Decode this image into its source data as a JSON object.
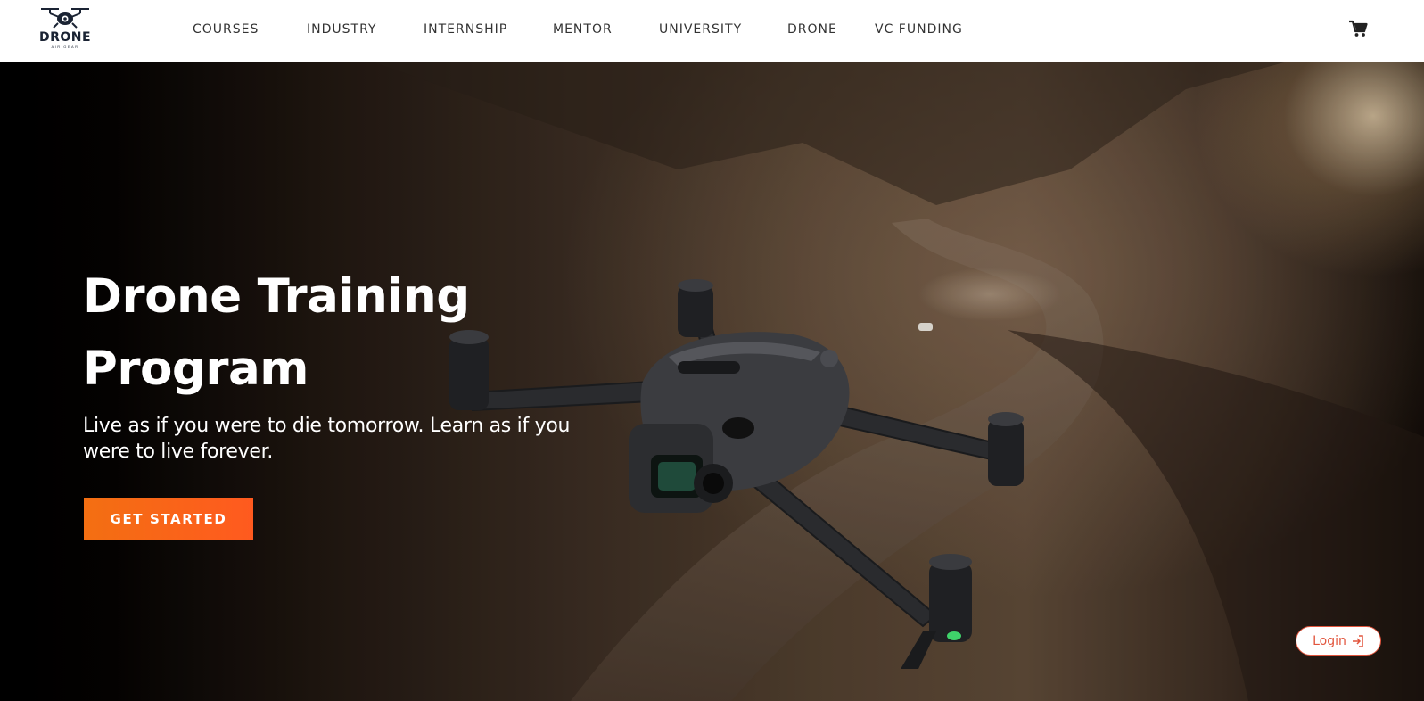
{
  "brand": {
    "name": "DRONE",
    "tagline": "AIR GEAR"
  },
  "nav": {
    "items": [
      {
        "label": "COURSES"
      },
      {
        "label": "INDUSTRY"
      },
      {
        "label": "INTERNSHIP"
      },
      {
        "label": "MENTOR"
      },
      {
        "label": "UNIVERSITY"
      },
      {
        "label": "DRONE"
      },
      {
        "label": "VC FUNDING"
      }
    ],
    "cart_icon": "shopping-cart-icon"
  },
  "hero": {
    "title_line1": "Drone Training",
    "title_line2": "Program",
    "subtitle": "Live as if you were to die tomorrow. Learn as if you were to live forever.",
    "cta_label": "GET STARTED",
    "image": "drone-over-canyon-photo"
  },
  "login": {
    "label": "Login",
    "icon": "login-arrow-icon"
  },
  "colors": {
    "accent": "#f36f12",
    "login_accent": "#e2553d",
    "header_bg": "#ffffff",
    "nav_text": "#333333"
  }
}
